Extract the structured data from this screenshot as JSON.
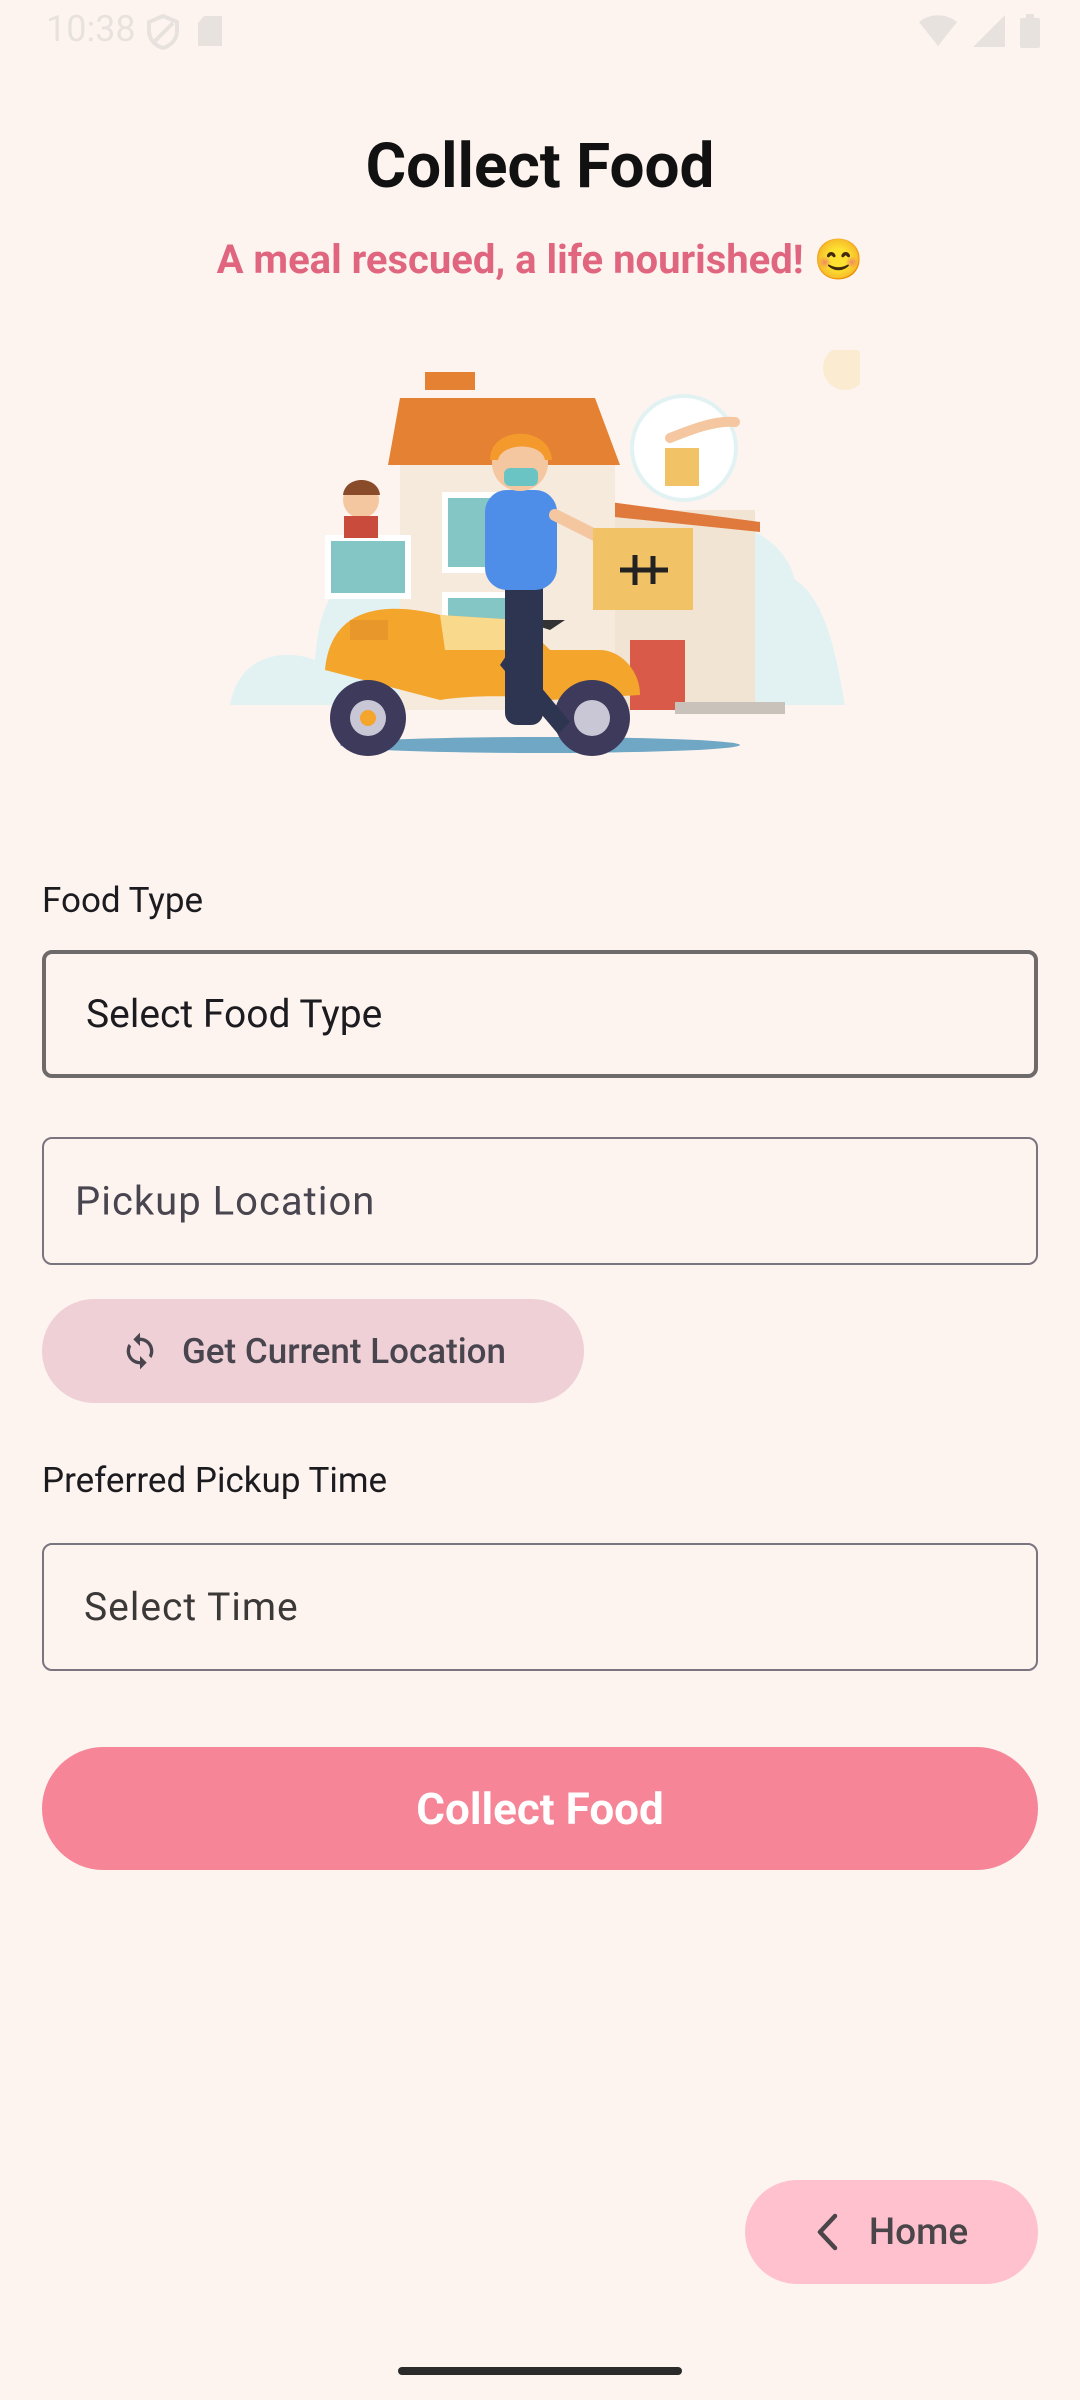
{
  "status_bar": {
    "time": "10:38",
    "left_icons": [
      "shield-icon",
      "sd-card-icon"
    ],
    "right_icons": [
      "wifi-icon",
      "signal-icon",
      "battery-icon"
    ]
  },
  "header": {
    "title": "Collect Food",
    "subtitle": "A meal rescued, a life nourished! 😊"
  },
  "form": {
    "food_type_label": "Food Type",
    "food_type_value": "Select Food Type",
    "pickup_location_placeholder": "Pickup Location",
    "get_location_label": "Get Current Location",
    "pickup_time_label": "Preferred Pickup Time",
    "pickup_time_value": "Select Time",
    "submit_label": "Collect Food"
  },
  "nav": {
    "home_label": "Home"
  },
  "colors": {
    "background": "#FDF4F0",
    "accent": "#F58597",
    "subtitle": "#E0657E",
    "home_button": "#FFC1CE",
    "location_button": "#EFD0D6"
  }
}
